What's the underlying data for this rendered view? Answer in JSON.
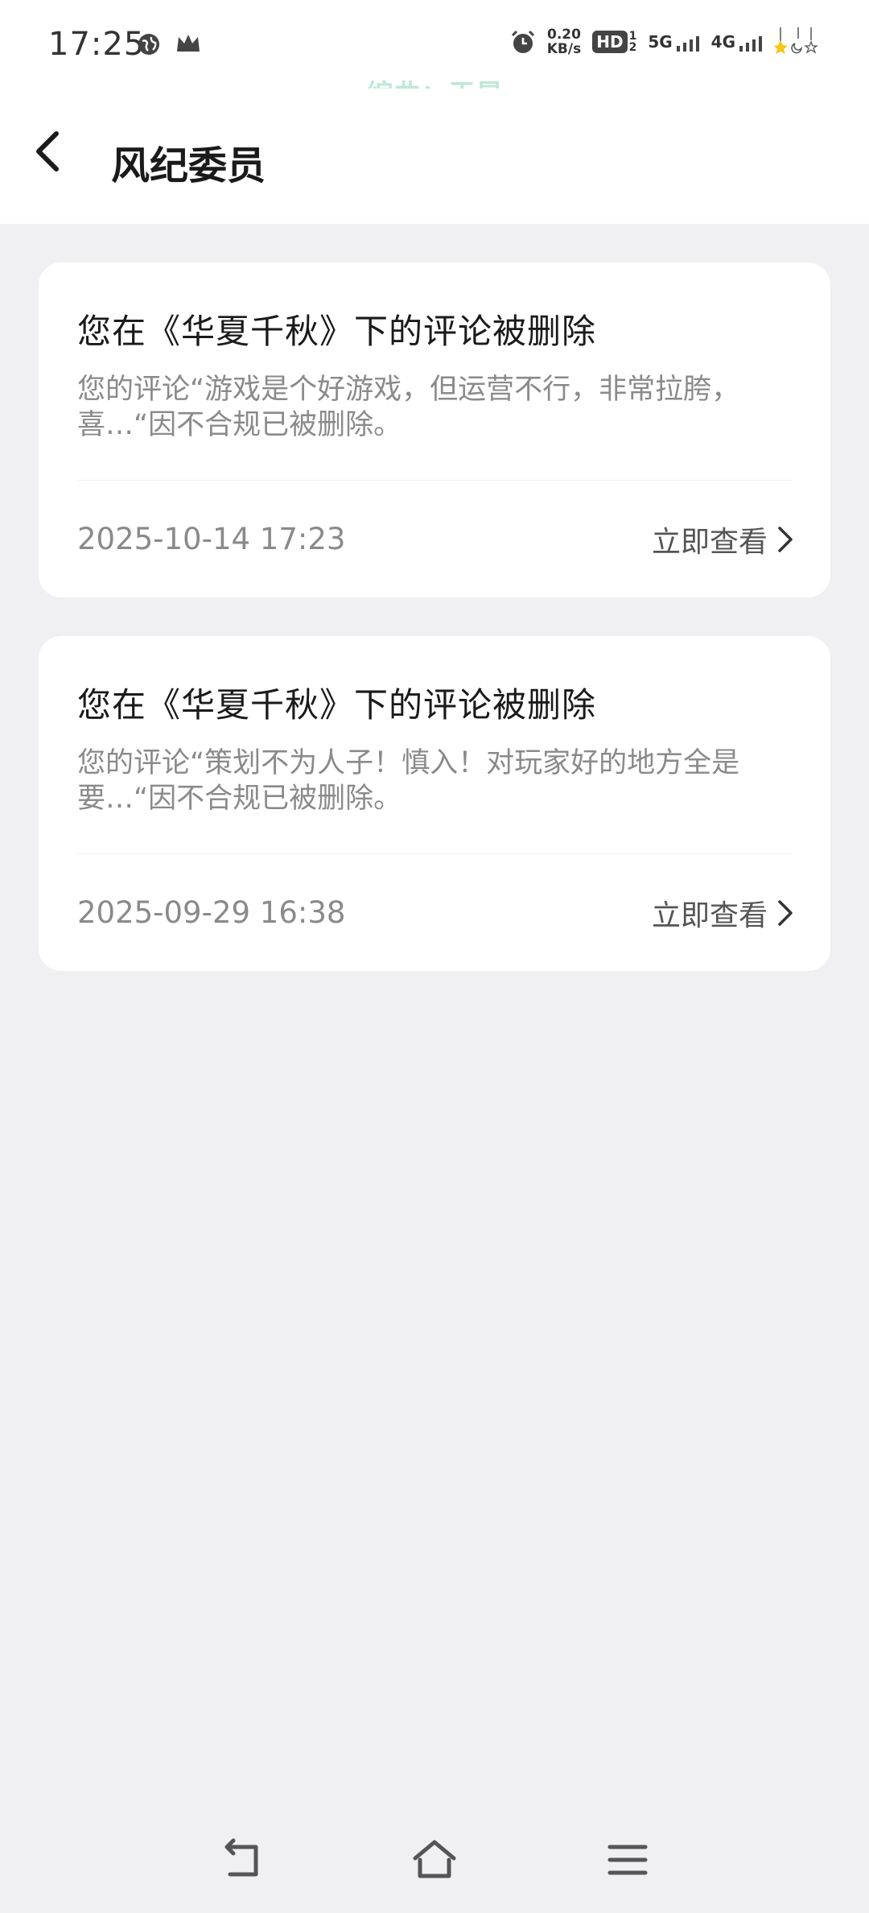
{
  "status_bar": {
    "time": "17:25",
    "net_speed_value": "0.20",
    "net_speed_unit": "KB/s",
    "hd_label": "HD",
    "sig1": "5G",
    "sig2": "4G",
    "icons": [
      "globe-icon",
      "crown-icon",
      "alarm-icon",
      "hd-icon",
      "signal-5g-icon",
      "signal-4g-icon",
      "decoration-icon"
    ]
  },
  "watermark": "编曲：于昊",
  "header": {
    "title": "风纪委员"
  },
  "notifications": [
    {
      "title": "您在《华夏千秋》下的评论被删除",
      "body": " 您的评论“游戏是个好游戏，但运营不行，非常拉胯，喜…“因不合规已被删除。",
      "time": "2025-10-14 17:23",
      "action": "立即查看"
    },
    {
      "title": "您在《华夏千秋》下的评论被删除",
      "body": " 您的评论“策划不为人子！慎入！对玩家好的地方全是要…“因不合规已被删除。",
      "time": "2025-09-29 16:38",
      "action": "立即查看"
    }
  ],
  "nav_bar": {
    "icons": [
      "back-nav-icon",
      "home-icon",
      "menu-icon"
    ]
  },
  "colors": {
    "background": "#f0f0f2",
    "card": "#ffffff",
    "watermark": "#bfe8d6"
  }
}
